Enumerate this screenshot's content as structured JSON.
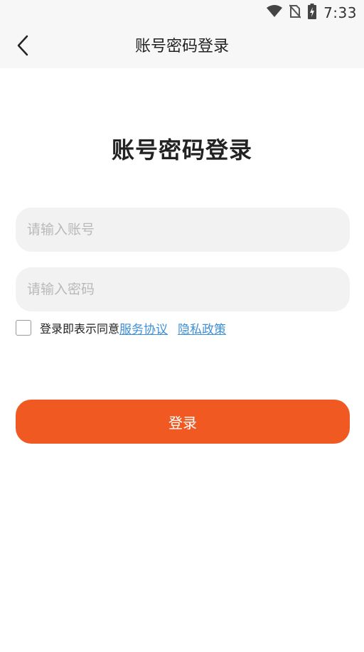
{
  "status_bar": {
    "time": "7:33",
    "icons": [
      "wifi-icon",
      "no-sim-icon",
      "battery-charging-icon"
    ]
  },
  "nav": {
    "title": "账号密码登录",
    "back_icon": "chevron-left-icon"
  },
  "heading": "账号密码登录",
  "account_input": {
    "placeholder": "请输入账号",
    "value": ""
  },
  "password_input": {
    "placeholder": "请输入密码",
    "value": ""
  },
  "agreement": {
    "checked": false,
    "text": "登录即表示同意",
    "service_link": "服务协议",
    "privacy_link": "隐私政策"
  },
  "login_button": {
    "label": "登录"
  },
  "colors": {
    "accent": "#f05a22",
    "link": "#3d8fd8",
    "input_bg": "#f2f2f2",
    "header_bg": "#f7f7f7"
  }
}
